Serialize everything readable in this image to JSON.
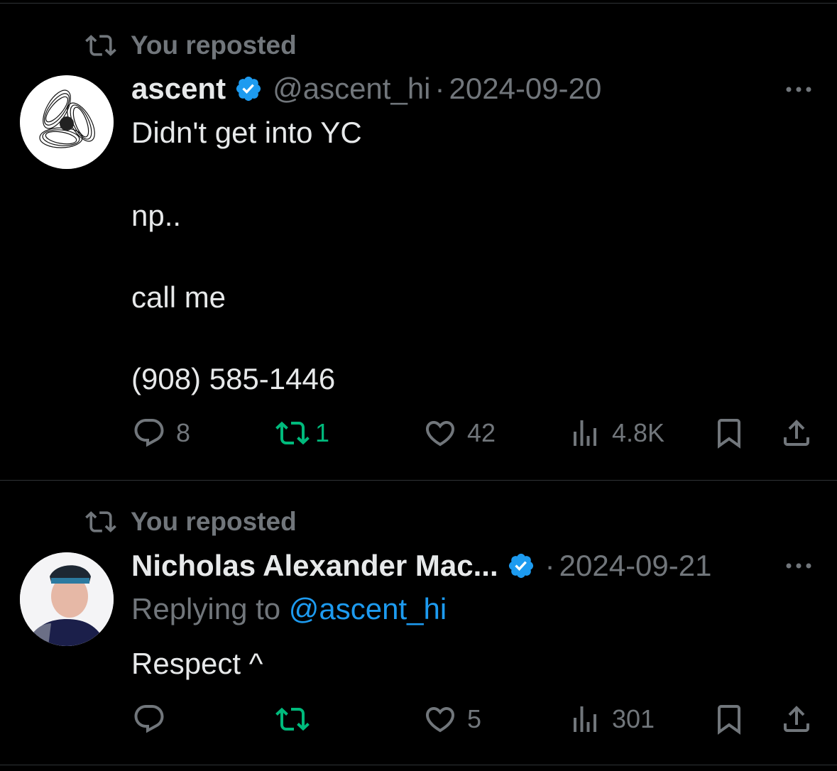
{
  "tweets": [
    {
      "repost_label": "You reposted",
      "author_name": "ascent",
      "handle": "@ascent_hi",
      "separator": "·",
      "date": "2024-09-20",
      "lines": [
        "Didn't get into YC",
        "np..",
        "call me",
        "(908) 585-1446"
      ],
      "replies": "8",
      "reposts": "1",
      "likes": "42",
      "views": "4.8K"
    },
    {
      "repost_label": "You reposted",
      "author_name": "Nicholas Alexander Mac...",
      "separator": "·",
      "date": "2024-09-21",
      "replying_prefix": "Replying to ",
      "replying_handle": "@ascent_hi",
      "lines": [
        "Respect ^"
      ],
      "replies": "",
      "reposts": "",
      "likes": "5",
      "views": "301"
    }
  ],
  "colors": {
    "background": "#000000",
    "text": "#e7e9ea",
    "muted": "#71767b",
    "accent": "#1d9bf0",
    "repost_green": "#00ba7c",
    "divider": "#2f3336"
  },
  "icons": {
    "repost": "repost-icon",
    "verified": "verified-badge-icon",
    "more": "more-icon",
    "reply": "reply-icon",
    "like": "like-icon",
    "views": "views-icon",
    "bookmark": "bookmark-icon",
    "share": "share-icon"
  }
}
